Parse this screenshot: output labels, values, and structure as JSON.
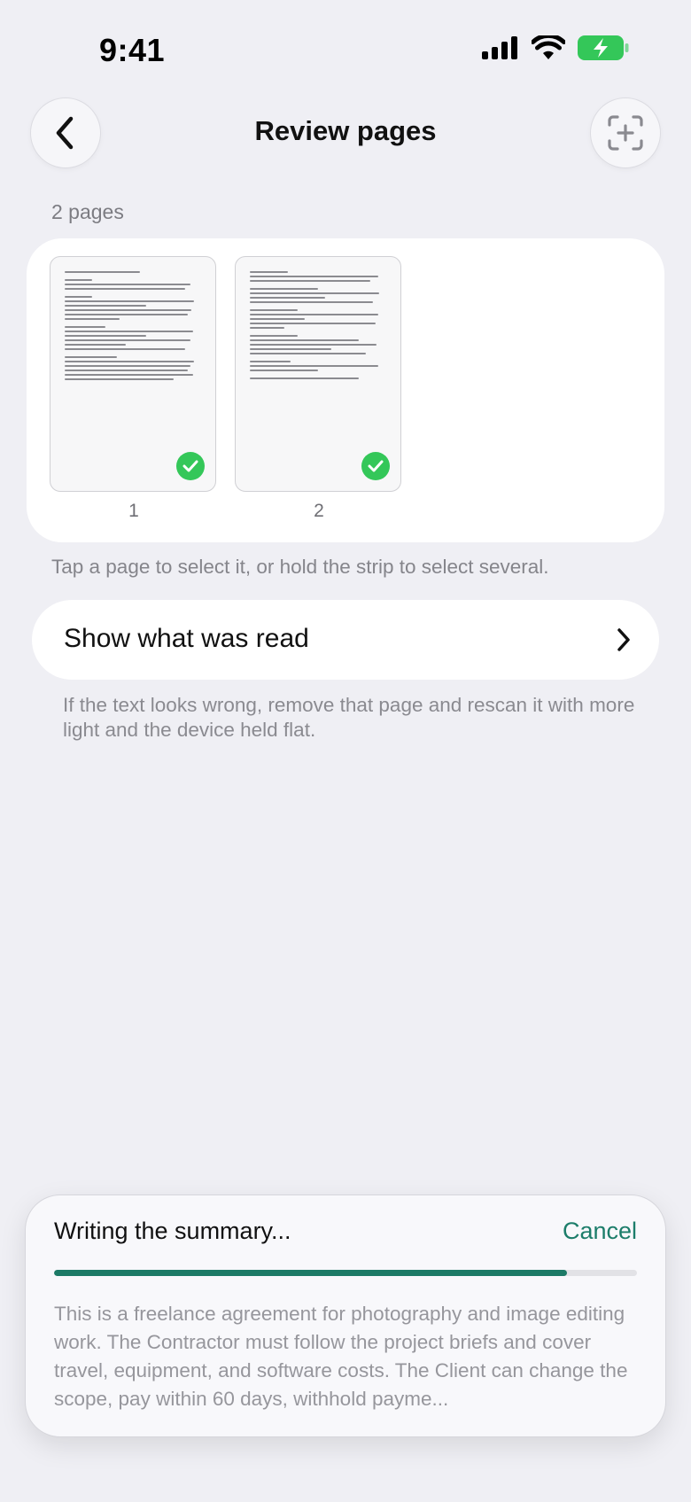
{
  "status_bar": {
    "time": "9:41"
  },
  "nav": {
    "title": "Review pages"
  },
  "pages": {
    "count_label": "2 pages",
    "items": [
      {
        "number": "1",
        "selected": true
      },
      {
        "number": "2",
        "selected": true
      }
    ]
  },
  "hint": "Tap a page to select it, or hold the strip to select several.",
  "show_read": {
    "label": "Show what was read"
  },
  "help_text": "If the text looks wrong, remove that page and rescan it with more light and the device held flat.",
  "summary_sheet": {
    "title": "Writing the summary...",
    "cancel_label": "Cancel",
    "progress": 0.88,
    "preview": "This is a freelance agreement for photography and image editing work. The Contractor must follow the project briefs and cover travel, equipment, and software costs. The Client can change the scope, pay within 60 days, withhold payme..."
  },
  "colors": {
    "accent": "#1c7d6a",
    "check_green": "#34c759",
    "background": "#efeff4"
  }
}
